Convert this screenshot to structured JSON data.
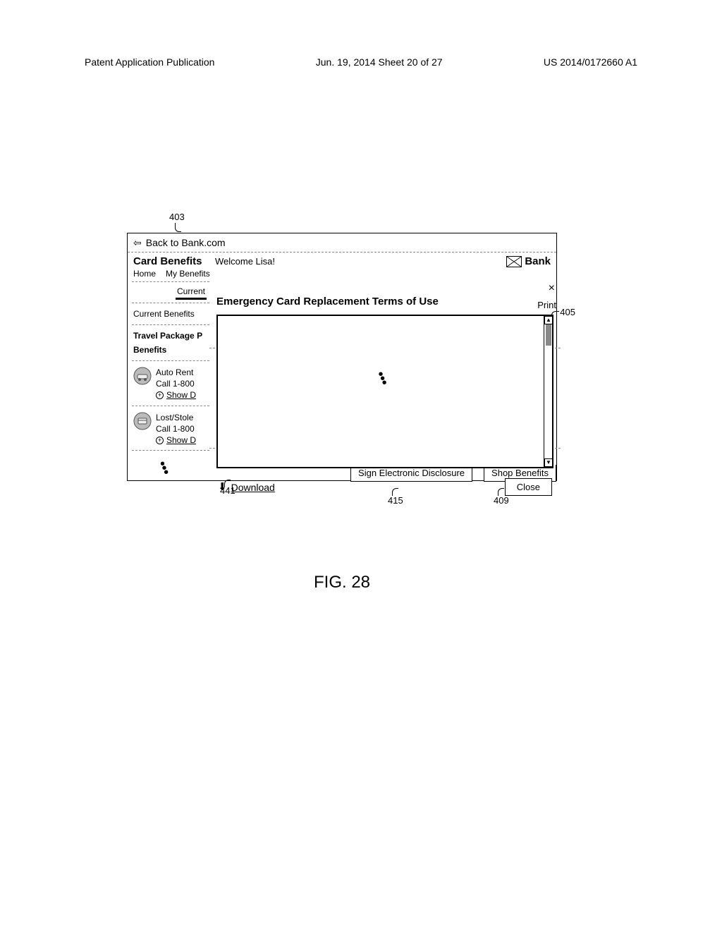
{
  "header": {
    "left": "Patent Application Publication",
    "center": "Jun. 19, 2014  Sheet 20 of 27",
    "right": "US 2014/0172660 A1"
  },
  "refs": {
    "r403": "403",
    "r405": "405",
    "r441": "441",
    "r415": "415",
    "r409": "409"
  },
  "window": {
    "back_label": "Back to Bank.com",
    "title": "Card Benefits",
    "welcome": "Welcome Lisa!",
    "bank_label": "Bank",
    "nav": {
      "home": "Home",
      "my_benefits": "My Benefits"
    }
  },
  "sidebar": {
    "tab_current": "Current",
    "current_benefits": "Current Benefits",
    "travel_pkg": "Travel Package P",
    "benefits_label": "Benefits",
    "items": [
      {
        "line1": "Auto Rent",
        "line2": "Call 1-800",
        "show": "Show D"
      },
      {
        "line1": "Lost/Stole",
        "line2": "Call 1-800",
        "show": "Show D"
      }
    ]
  },
  "modal": {
    "close_x": "×",
    "title": "Emergency Card Replacement Terms of Use",
    "print": "Print",
    "download": "Download",
    "close_btn": "Close"
  },
  "bg": {
    "sign": "Sign Electronic Disclosure",
    "shop": "Shop Benefits"
  },
  "figure_caption": "FIG. 28"
}
